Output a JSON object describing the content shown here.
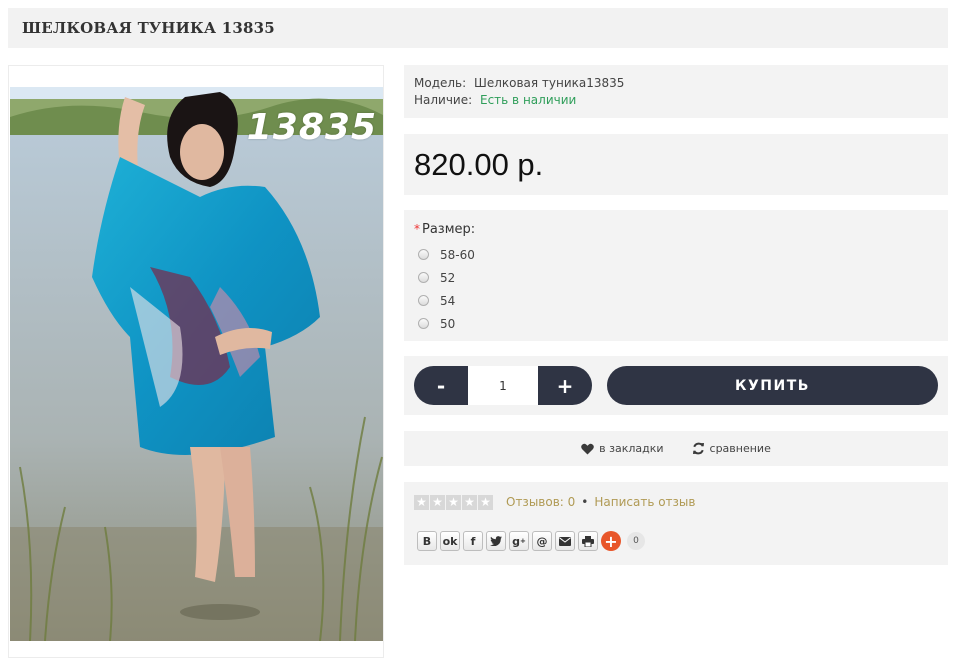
{
  "product": {
    "title": "ШЕЛКОВАЯ ТУНИКА 13835",
    "image_number": "13835",
    "model_label": "Модель:",
    "model_value": "Шелковая туника13835",
    "stock_label": "Наличие:",
    "stock_value": "Есть в наличии",
    "price": "820.00 р."
  },
  "options": {
    "required_mark": "*",
    "label": "Размер:",
    "sizes": [
      "58-60",
      "52",
      "54",
      "50"
    ]
  },
  "cart": {
    "minus_label": "-",
    "plus_label": "+",
    "quantity": "1",
    "buy_label": "КУПИТЬ"
  },
  "links": {
    "wishlist_label": "в закладки",
    "compare_label": "сравнение"
  },
  "review": {
    "reviews_text": "Отзывов: 0",
    "separator": "•",
    "write_review": "Написать отзыв",
    "rating": 0,
    "rating_max": 5
  },
  "share": {
    "buttons": [
      "vk-icon",
      "odnoklassniki-icon",
      "facebook-icon",
      "twitter-icon",
      "google-plus-icon",
      "mail-ru-icon",
      "email-icon",
      "print-icon"
    ],
    "count": "0"
  },
  "colors": {
    "dark_button": "#2f3444",
    "stock_green": "#2f9e5a",
    "review_link": "#b09a54",
    "panel_bg": "#f3f3f3",
    "share_plus": "#e8562a"
  }
}
